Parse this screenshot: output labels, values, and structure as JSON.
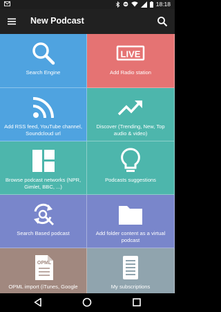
{
  "status": {
    "time": "18:18"
  },
  "toolbar": {
    "title": "New Podcast"
  },
  "tiles": [
    {
      "label": "Search Engine",
      "color": "#4fa3e0",
      "icon": "search-icon"
    },
    {
      "label": "Add Radio station",
      "color": "#e57373",
      "icon": "live-icon",
      "icon_text": "LIVE"
    },
    {
      "label": "Add RSS feed, YouTube channel, Soundcloud url",
      "color": "#4fa3e0",
      "icon": "rss-icon"
    },
    {
      "label": "Discover (Trending, New, Top audio & video)",
      "color": "#4db6ac",
      "icon": "trending-icon"
    },
    {
      "label": "Browse podcast networks (NPR, Gimlet, BBC, ...)",
      "color": "#4db6ac",
      "icon": "dashboard-icon"
    },
    {
      "label": "Podcasts suggestions",
      "color": "#4db6ac",
      "icon": "lightbulb-icon"
    },
    {
      "label": "Search Based podcast",
      "color": "#7986cb",
      "icon": "refresh-search-icon"
    },
    {
      "label": "Add folder content as a virtual podcast",
      "color": "#7986cb",
      "icon": "folder-icon"
    },
    {
      "label": "OPML import (iTunes, Google",
      "color": "#a1887f",
      "icon": "opml-file-icon",
      "icon_text": "OPML"
    },
    {
      "label": "My subscriptions",
      "color": "#90a4ae",
      "icon": "list-document-icon"
    }
  ]
}
